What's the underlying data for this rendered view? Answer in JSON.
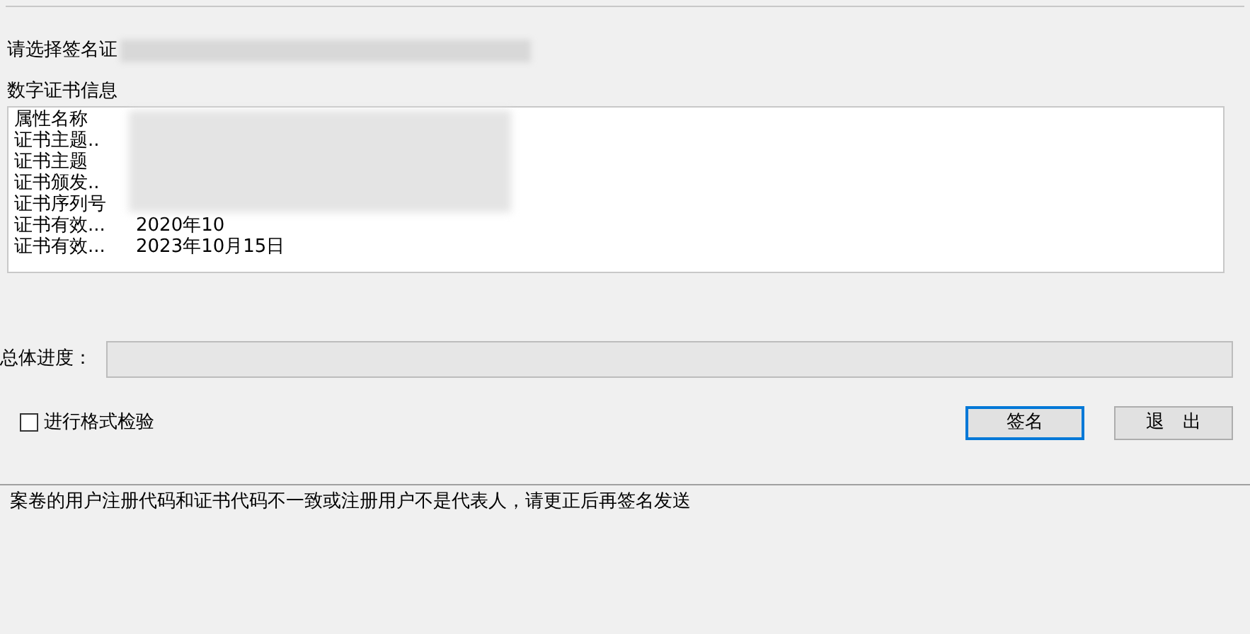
{
  "cert_select": {
    "label": "请选择签名证"
  },
  "cert_info": {
    "title": "数字证书信息",
    "rows": [
      {
        "name": "属性名称"
      },
      {
        "name": "证书主题.."
      },
      {
        "name": "证书主题"
      },
      {
        "name": "证书颁发.."
      },
      {
        "name": "证书序列号"
      },
      {
        "name": "证书有效...",
        "value": "2020年10"
      },
      {
        "name": "证书有效...",
        "value": "2023年10月15日"
      }
    ]
  },
  "progress": {
    "label": "总体进度："
  },
  "format_check": {
    "label": "进行格式检验",
    "checked": false
  },
  "buttons": [
    {
      "label": "签名",
      "selected": true
    },
    {
      "label": "退　出",
      "selected": false
    }
  ],
  "message": "案卷的用户注册代码和证书代码不一致或注册用户不是代表人，请更正后再签名发送"
}
